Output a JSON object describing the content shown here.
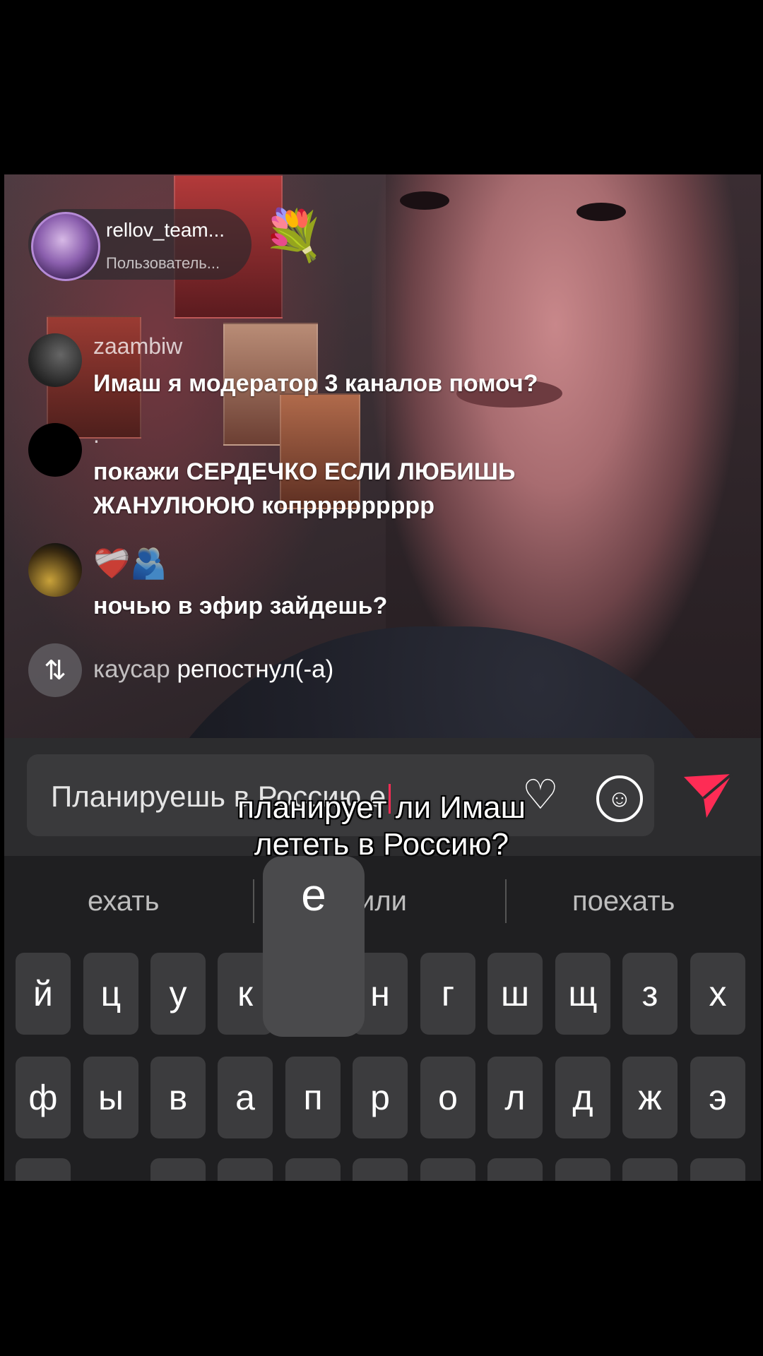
{
  "host": {
    "name": "rellov_team...",
    "subtitle": "Пользователь...",
    "flower_emoji": "💐"
  },
  "comments": [
    {
      "user": "zaambiw",
      "text": "Имаш я модератор 3 каналов помоч?"
    },
    {
      "user": ".",
      "text_line1": "покажи СЕРДЕЧКО ЕСЛИ ЛЮБИШЬ",
      "text_line2": "ЖАНУЛЮЮЮ копррррррррр"
    },
    {
      "user": "❤️‍🩹🫂",
      "text": "ночью в эфир зайдешь?"
    }
  ],
  "repost": {
    "user": "каусар",
    "action": "репостнул(-а)",
    "icon": "repost-icon"
  },
  "input": {
    "value": "Планируешь в Россию е"
  },
  "caption": {
    "line1": "планирует ли Имаш",
    "line2": "лететь в Россию?"
  },
  "keyboard": {
    "suggestions": [
      "ехать",
      "или",
      "поехать"
    ],
    "popup_key": "е",
    "row1": [
      "й",
      "ц",
      "у",
      "к",
      "",
      "н",
      "г",
      "ш",
      "щ",
      "з",
      "х"
    ],
    "row2": [
      "ф",
      "ы",
      "в",
      "а",
      "п",
      "р",
      "о",
      "л",
      "д",
      "ж",
      "э"
    ]
  },
  "colors": {
    "accent": "#fe2c55",
    "keyboard_bg": "#1f1f21",
    "key_bg": "#3c3c3e"
  }
}
